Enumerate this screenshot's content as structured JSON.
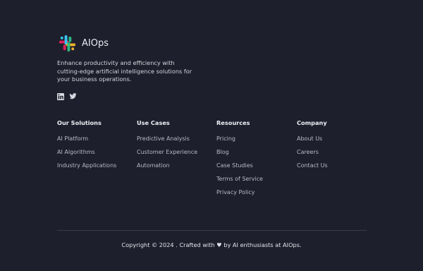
{
  "brand": {
    "name": "AIOps",
    "logo_icon": "slack-like-logo-icon"
  },
  "tagline": "Enhance productivity and efficiency with cutting-edge artificial intelligence solutions for your business operations.",
  "socials": [
    {
      "name": "linkedin-icon"
    },
    {
      "name": "twitter-icon"
    }
  ],
  "columns": [
    {
      "title": "Our Solutions",
      "items": [
        "AI Platform",
        "AI Algorithms",
        "Industry Applications"
      ]
    },
    {
      "title": "Use Cases",
      "items": [
        "Predictive Analysis",
        "Customer Experience",
        "Automation"
      ]
    },
    {
      "title": "Resources",
      "items": [
        "Pricing",
        "Blog",
        "Case Studies",
        "Terms of Service",
        "Privacy Policy"
      ]
    },
    {
      "title": "Company",
      "items": [
        "About Us",
        "Careers",
        "Contact Us"
      ]
    }
  ],
  "footer": {
    "copyright": "Copyright © 2024 . Crafted with ♥ by AI enthusiasts at AIOps."
  },
  "colors": {
    "background": "#1e1f2c",
    "text": "#d7d8e0",
    "muted": "#b8bac6"
  }
}
